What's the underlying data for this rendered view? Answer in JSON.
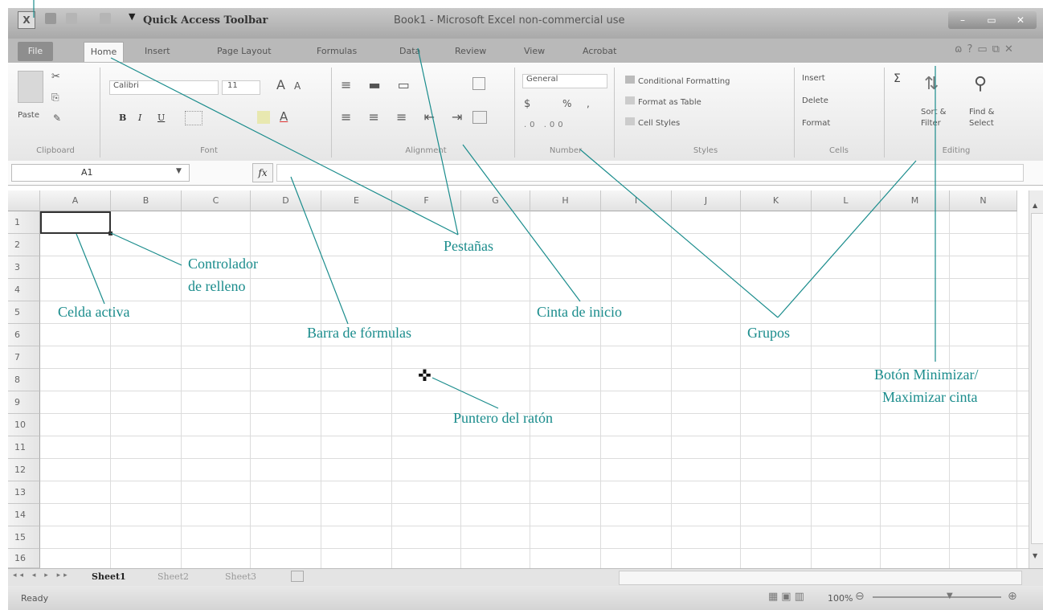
{
  "window": {
    "app_icon": "X",
    "title": "Book1 - Microsoft Excel non-commercial use",
    "qat_label": "Quick Access Toolbar",
    "buttons": [
      "minimize",
      "restore",
      "close"
    ]
  },
  "ribbon": {
    "tabs": [
      "File",
      "Home",
      "Insert",
      "Page Layout",
      "Formulas",
      "Data",
      "Review",
      "View",
      "Acrobat"
    ],
    "clipboard": {
      "paste": "Paste",
      "label": "Clipboard"
    },
    "font": {
      "name": "Calibri",
      "size": "11",
      "bold": "B",
      "italic": "I",
      "underline": "U",
      "grow": "A",
      "shrink": "A",
      "color": "A",
      "label": "Font"
    },
    "alignment": {
      "label": "Alignment"
    },
    "number": {
      "format": "General",
      "currency": "$",
      "percent": "%",
      "comma": ",",
      "label": "Number"
    },
    "styles": {
      "conditional": "Conditional Formatting",
      "table": "Format as Table",
      "cell": "Cell Styles",
      "label": "Styles"
    },
    "cells": {
      "insert": "Insert",
      "delete": "Delete",
      "format": "Format",
      "label": "Cells"
    },
    "editing": {
      "sigma": "Σ",
      "sort1": "Sort &",
      "sort2": "Filter",
      "find1": "Find &",
      "find2": "Select",
      "label": "Editing"
    }
  },
  "formula_bar": {
    "name_box": "A1",
    "fx": "fx",
    "value": ""
  },
  "grid": {
    "columns": [
      "A",
      "B",
      "C",
      "D",
      "E",
      "F",
      "G",
      "H",
      "I",
      "J",
      "K",
      "L",
      "M",
      "N"
    ],
    "rows": [
      "1",
      "2",
      "3",
      "4",
      "5",
      "6",
      "7",
      "8",
      "9",
      "10",
      "11",
      "12",
      "13",
      "14",
      "15",
      "16"
    ],
    "active_cell": "A1"
  },
  "sheets": [
    "Sheet1",
    "Sheet2",
    "Sheet3"
  ],
  "status": {
    "ready": "Ready",
    "zoom": "100%"
  },
  "annotations": {
    "pestanas": "Pestañas",
    "controlador1": "Controlador",
    "controlador2": "de relleno",
    "celda": "Celda activa",
    "barra": "Barra de fórmulas",
    "cinta": "Cinta de inicio",
    "grupos": "Grupos",
    "boton1": "Botón Minimizar/",
    "boton2": "Maximizar cinta",
    "puntero": "Puntero del ratón"
  }
}
